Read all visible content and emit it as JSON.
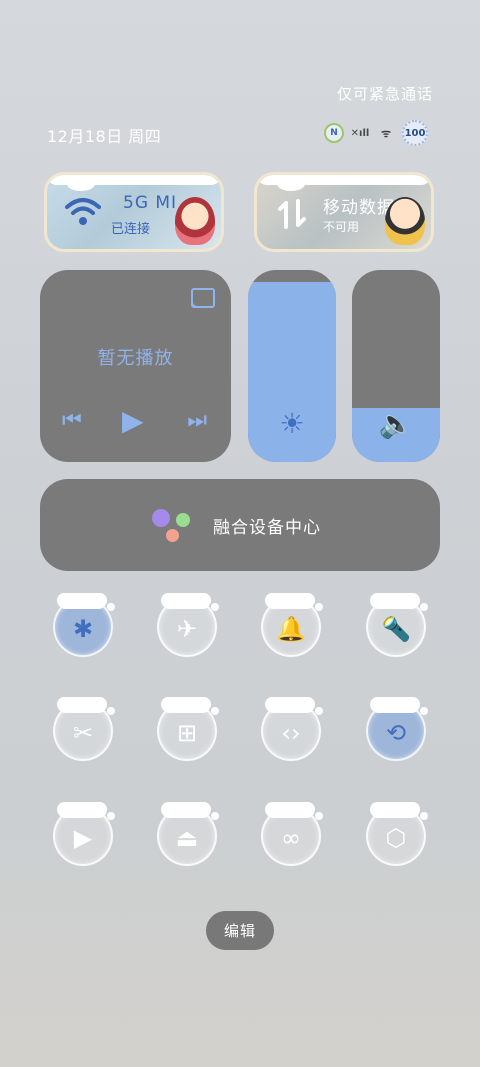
{
  "status": {
    "emergency_text": "仅可紧急通话",
    "date_text": "12月18日 周四",
    "icons": [
      {
        "name": "nfc-icon",
        "glyph": "N"
      },
      {
        "name": "no-sim-signal-icon",
        "glyph": "✕ıll"
      },
      {
        "name": "wifi-status-icon",
        "glyph": "ᯤ"
      },
      {
        "name": "battery-icon",
        "glyph": "100"
      }
    ]
  },
  "wifi_tile": {
    "icon": "wifi-icon",
    "title": "5G    MI",
    "subtitle": "已连接"
  },
  "data_tile": {
    "icon": "mobile-data-icon",
    "title": "移动数据",
    "subtitle": "不可用"
  },
  "media": {
    "title": "暂无播放",
    "prev_glyph": "⏮",
    "play_glyph": "▶",
    "next_glyph": "⏭"
  },
  "brightness": {
    "level": 0.94,
    "glyph": "☀"
  },
  "volume": {
    "level": 0.28,
    "glyph": "🔈"
  },
  "device_center": {
    "label": "融合设备中心"
  },
  "toggles": [
    {
      "name": "bluetooth-toggle",
      "icon": "bluetooth-icon",
      "glyph": "✱",
      "on": true
    },
    {
      "name": "airplane-mode-toggle",
      "icon": "airplane-icon",
      "glyph": "✈",
      "on": false
    },
    {
      "name": "ring-mode-toggle",
      "icon": "bell-icon",
      "glyph": "🔔",
      "on": false
    },
    {
      "name": "flashlight-toggle",
      "icon": "flashlight-icon",
      "glyph": "🔦",
      "on": false
    },
    {
      "name": "screenshot-toggle",
      "icon": "screenshot-scissors-icon",
      "glyph": "✂",
      "on": false
    },
    {
      "name": "battery-saver-toggle",
      "icon": "battery-saver-icon",
      "glyph": "⊞",
      "on": false
    },
    {
      "name": "code-share-toggle",
      "icon": "share-code-icon",
      "glyph": "‹›",
      "on": false
    },
    {
      "name": "rotation-lock-toggle",
      "icon": "rotation-lock-icon",
      "glyph": "⟲",
      "on": true
    },
    {
      "name": "screen-record-toggle",
      "icon": "video-camera-icon",
      "glyph": "▶",
      "on": false
    },
    {
      "name": "screen-cast-toggle",
      "icon": "cast-screen-icon",
      "glyph": "⏏",
      "on": false
    },
    {
      "name": "hotspot-link-toggle",
      "icon": "link-icon",
      "glyph": "∞",
      "on": false
    },
    {
      "name": "settings-toggle",
      "icon": "settings-hex-icon",
      "glyph": "⬡",
      "on": false
    }
  ],
  "edit_button": {
    "label": "编辑"
  }
}
